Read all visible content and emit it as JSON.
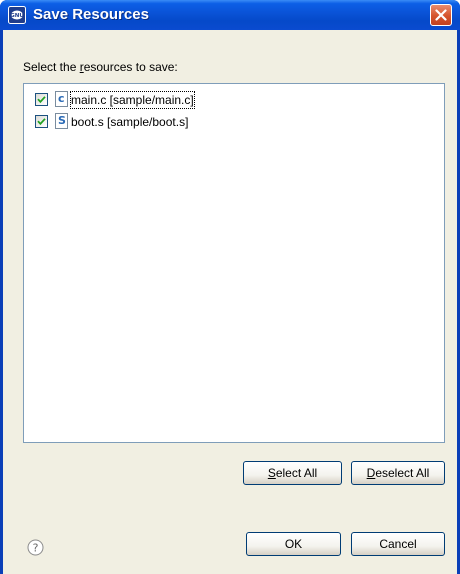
{
  "window": {
    "title": "Save Resources",
    "app_icon": "gnu-icon",
    "close_icon": "close-icon"
  },
  "dialog": {
    "prompt_prefix": "Select the ",
    "prompt_mnemonic": "r",
    "prompt_suffix": "esources to save:"
  },
  "resources": [
    {
      "label": "main.c  [sample/main.c]",
      "checked": true,
      "icon": "c-file-icon",
      "glyph": "c",
      "glyph_color": "#2a6ab6",
      "focused": true
    },
    {
      "label": "boot.s  [sample/boot.s]",
      "checked": true,
      "icon": "s-file-icon",
      "glyph": "S",
      "glyph_color": "#2a6ab6",
      "focused": false
    }
  ],
  "buttons": {
    "select_all": {
      "mnemonic": "S",
      "rest": "elect All"
    },
    "deselect_all": {
      "mnemonic": "D",
      "rest": "eselect All"
    },
    "ok": "OK",
    "cancel": "Cancel"
  },
  "colors": {
    "title_bar": "#0a52d6",
    "close_button": "#d5542c",
    "dialog_bg": "#f1efe2",
    "checkmark": "#21a121"
  }
}
